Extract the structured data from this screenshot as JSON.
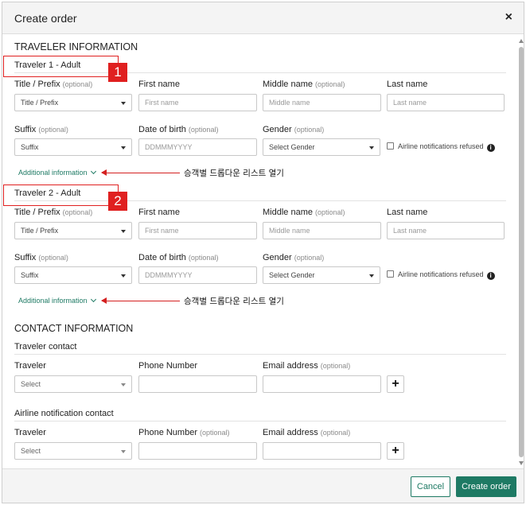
{
  "dialog": {
    "title": "Create order",
    "close_glyph": "×"
  },
  "traveler_section": {
    "heading": "TRAVELER INFORMATION",
    "travelers": [
      {
        "name": "Traveler 1 - Adult",
        "annotation_number": "1",
        "fields": {
          "title_label": "Title / Prefix",
          "title_optional": "(optional)",
          "title_value": "Title / Prefix",
          "first_label": "First name",
          "first_placeholder": "First name",
          "middle_label": "Middle name",
          "middle_optional": "(optional)",
          "middle_placeholder": "Middle name",
          "last_label": "Last name",
          "last_placeholder": "Last name",
          "suffix_label": "Suffix",
          "suffix_optional": "(optional)",
          "suffix_value": "Suffix",
          "dob_label": "Date of birth",
          "dob_optional": "(optional)",
          "dob_placeholder": "DDMMMYYYY",
          "gender_label": "Gender",
          "gender_optional": "(optional)",
          "gender_value": "Select Gender",
          "airline_refused": "Airline notifications refused"
        },
        "additional_link": "Additional information",
        "annotation_note": "승객별 드롭다운 리스트 열기"
      },
      {
        "name": "Traveler 2 - Adult",
        "annotation_number": "2",
        "fields": {
          "title_label": "Title / Prefix",
          "title_optional": "(optional)",
          "title_value": "Title / Prefix",
          "first_label": "First name",
          "first_placeholder": "First name",
          "middle_label": "Middle name",
          "middle_optional": "(optional)",
          "middle_placeholder": "Middle name",
          "last_label": "Last name",
          "last_placeholder": "Last name",
          "suffix_label": "Suffix",
          "suffix_optional": "(optional)",
          "suffix_value": "Suffix",
          "dob_label": "Date of birth",
          "dob_optional": "(optional)",
          "dob_placeholder": "DDMMMYYYY",
          "gender_label": "Gender",
          "gender_optional": "(optional)",
          "gender_value": "Select Gender",
          "airline_refused": "Airline notifications refused"
        },
        "additional_link": "Additional information",
        "annotation_note": "승객별 드롭다운 리스트 열기"
      }
    ]
  },
  "contact_section": {
    "heading": "CONTACT INFORMATION",
    "traveler_contact": {
      "subtitle": "Traveler contact",
      "traveler_label": "Traveler",
      "traveler_value": "Select",
      "phone_label": "Phone Number",
      "phone_optional": "",
      "email_label": "Email address",
      "email_optional": "(optional)",
      "add_glyph": "+"
    },
    "airline_contact": {
      "subtitle": "Airline notification contact",
      "traveler_label": "Traveler",
      "traveler_value": "Select",
      "phone_label": "Phone Number",
      "phone_optional": "(optional)",
      "email_label": "Email address",
      "email_optional": "(optional)",
      "add_glyph": "+"
    }
  },
  "footer": {
    "cancel_label": "Cancel",
    "create_label": "Create order"
  },
  "colors": {
    "accent": "#1e7a64",
    "annotation": "#e02020"
  }
}
